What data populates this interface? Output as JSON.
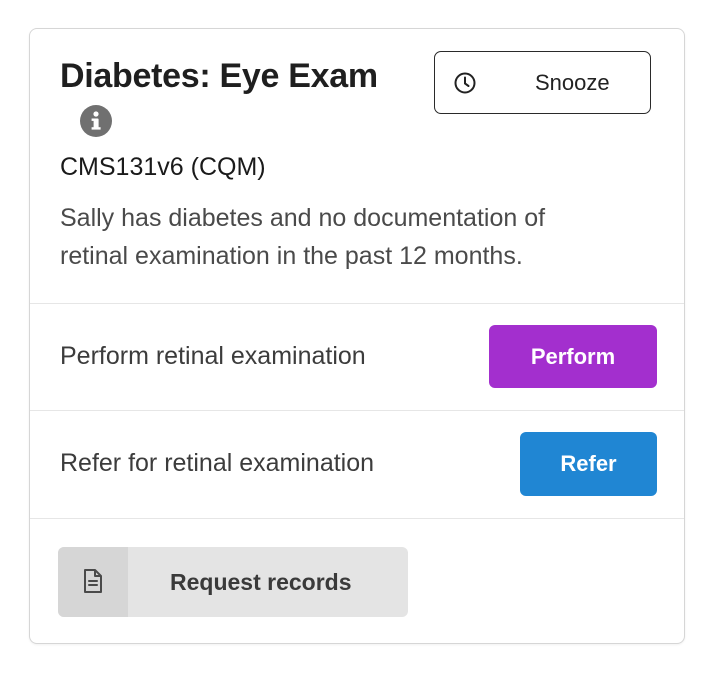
{
  "card": {
    "title": "Diabetes: Eye Exam",
    "measure": "CMS131v6 (CQM)",
    "description": "Sally has diabetes and no documentation of retinal examination in the past 12 months.",
    "snooze_label": "Snooze"
  },
  "actions": [
    {
      "label": "Perform retinal examination",
      "button_label": "Perform",
      "button_color": "#a32fce"
    },
    {
      "label": "Refer for retinal examination",
      "button_label": "Refer",
      "button_color": "#2086d3"
    }
  ],
  "request": {
    "label": "Request records"
  },
  "icons": {
    "info": "info-circle-icon",
    "snooze": "clock-icon",
    "request": "document-icon"
  },
  "colors": {
    "perform": "#a32fce",
    "refer": "#2086d3",
    "request_bg": "#e4e4e4"
  }
}
